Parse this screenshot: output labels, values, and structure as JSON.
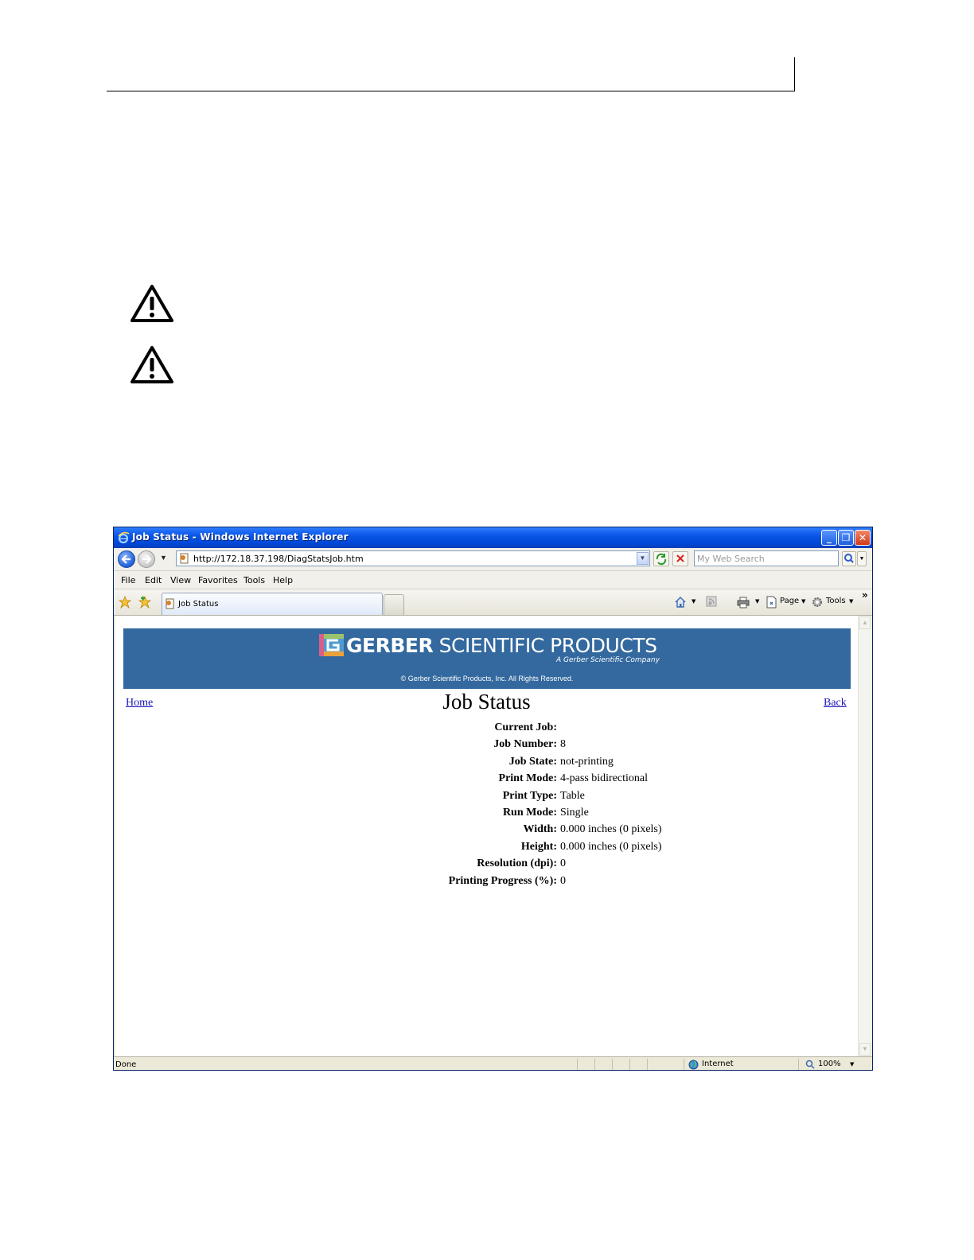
{
  "window": {
    "title": "Job Status - Windows Internet Explorer",
    "minimize_glyph": "_",
    "restore_glyph": "❐",
    "close_glyph": "✕"
  },
  "address_bar": {
    "url": "http://172.18.37.198/DiagStatsJob.htm",
    "search_placeholder": "My Web Search"
  },
  "menu": [
    "File",
    "Edit",
    "View",
    "Favorites",
    "Tools",
    "Help"
  ],
  "tab": {
    "label": "Job Status"
  },
  "command_bar": {
    "page_label": "Page",
    "tools_label": "Tools",
    "overflow": "»"
  },
  "banner": {
    "brand_bold": "GERBER",
    "brand_rest": " SCIENTIFIC PRODUCTS",
    "tagline": "A Gerber Scientific Company",
    "copyright": "© Gerber Scientific Products, Inc. All Rights Reserved."
  },
  "page": {
    "home_link": "Home",
    "back_link": "Back",
    "title": "Job Status",
    "stats": [
      {
        "label": "Current Job:",
        "value": ""
      },
      {
        "label": "Job Number:",
        "value": "8"
      },
      {
        "label": "Job State:",
        "value": "not-printing"
      },
      {
        "label": "Print Mode:",
        "value": "4-pass bidirectional"
      },
      {
        "label": "Print Type:",
        "value": "Table"
      },
      {
        "label": "Run Mode:",
        "value": "Single"
      },
      {
        "label": "Width:",
        "value": "0.000 inches (0 pixels)"
      },
      {
        "label": "Height:",
        "value": "0.000 inches (0 pixels)"
      },
      {
        "label": "Resolution (dpi):",
        "value": "0"
      },
      {
        "label": "Printing Progress (%):",
        "value": "0"
      }
    ]
  },
  "status_bar": {
    "text": "Done",
    "zone": "Internet",
    "zoom": "100%"
  },
  "colors": {
    "banner": "#33699e",
    "titlebar": "#0a56e8",
    "link": "#1a14b8"
  }
}
